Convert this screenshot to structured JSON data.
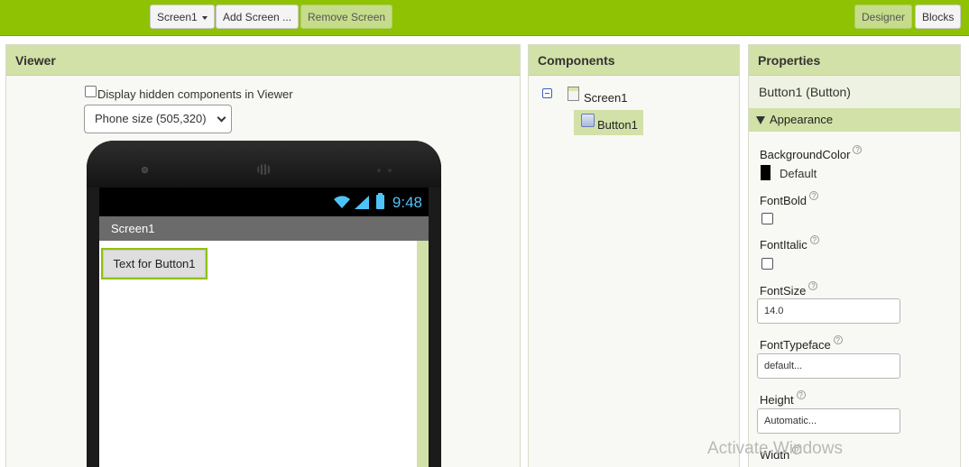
{
  "toolbar": {
    "screen_select": "Screen1",
    "add_screen": "Add Screen ...",
    "remove_screen": "Remove Screen",
    "designer": "Designer",
    "blocks": "Blocks"
  },
  "viewer": {
    "title": "Viewer",
    "hidden_checkbox_label": "Display hidden components in Viewer",
    "phone_size": "Phone size (505,320)",
    "phone": {
      "status_time": "9:48",
      "screen_title": "Screen1",
      "button_text": "Text for Button1"
    }
  },
  "components": {
    "title": "Components",
    "tree": [
      {
        "label": "Screen1"
      },
      {
        "label": "Button1"
      }
    ]
  },
  "properties": {
    "title": "Properties",
    "selected": "Button1 (Button)",
    "section": "Appearance",
    "items": {
      "background_color": {
        "label": "BackgroundColor",
        "value": "Default",
        "color": "#000000"
      },
      "font_bold": {
        "label": "FontBold"
      },
      "font_italic": {
        "label": "FontItalic"
      },
      "font_size": {
        "label": "FontSize",
        "value": "14.0"
      },
      "font_typeface": {
        "label": "FontTypeface",
        "value": "default..."
      },
      "height": {
        "label": "Height",
        "value": "Automatic..."
      },
      "width": {
        "label": "Width"
      }
    },
    "help_glyph": "?"
  },
  "watermark": "Activate Windows",
  "colors": {
    "toolbar_green": "#8fc202",
    "panel_header": "#d2e1a7",
    "status_blue": "#4fc3f7"
  }
}
